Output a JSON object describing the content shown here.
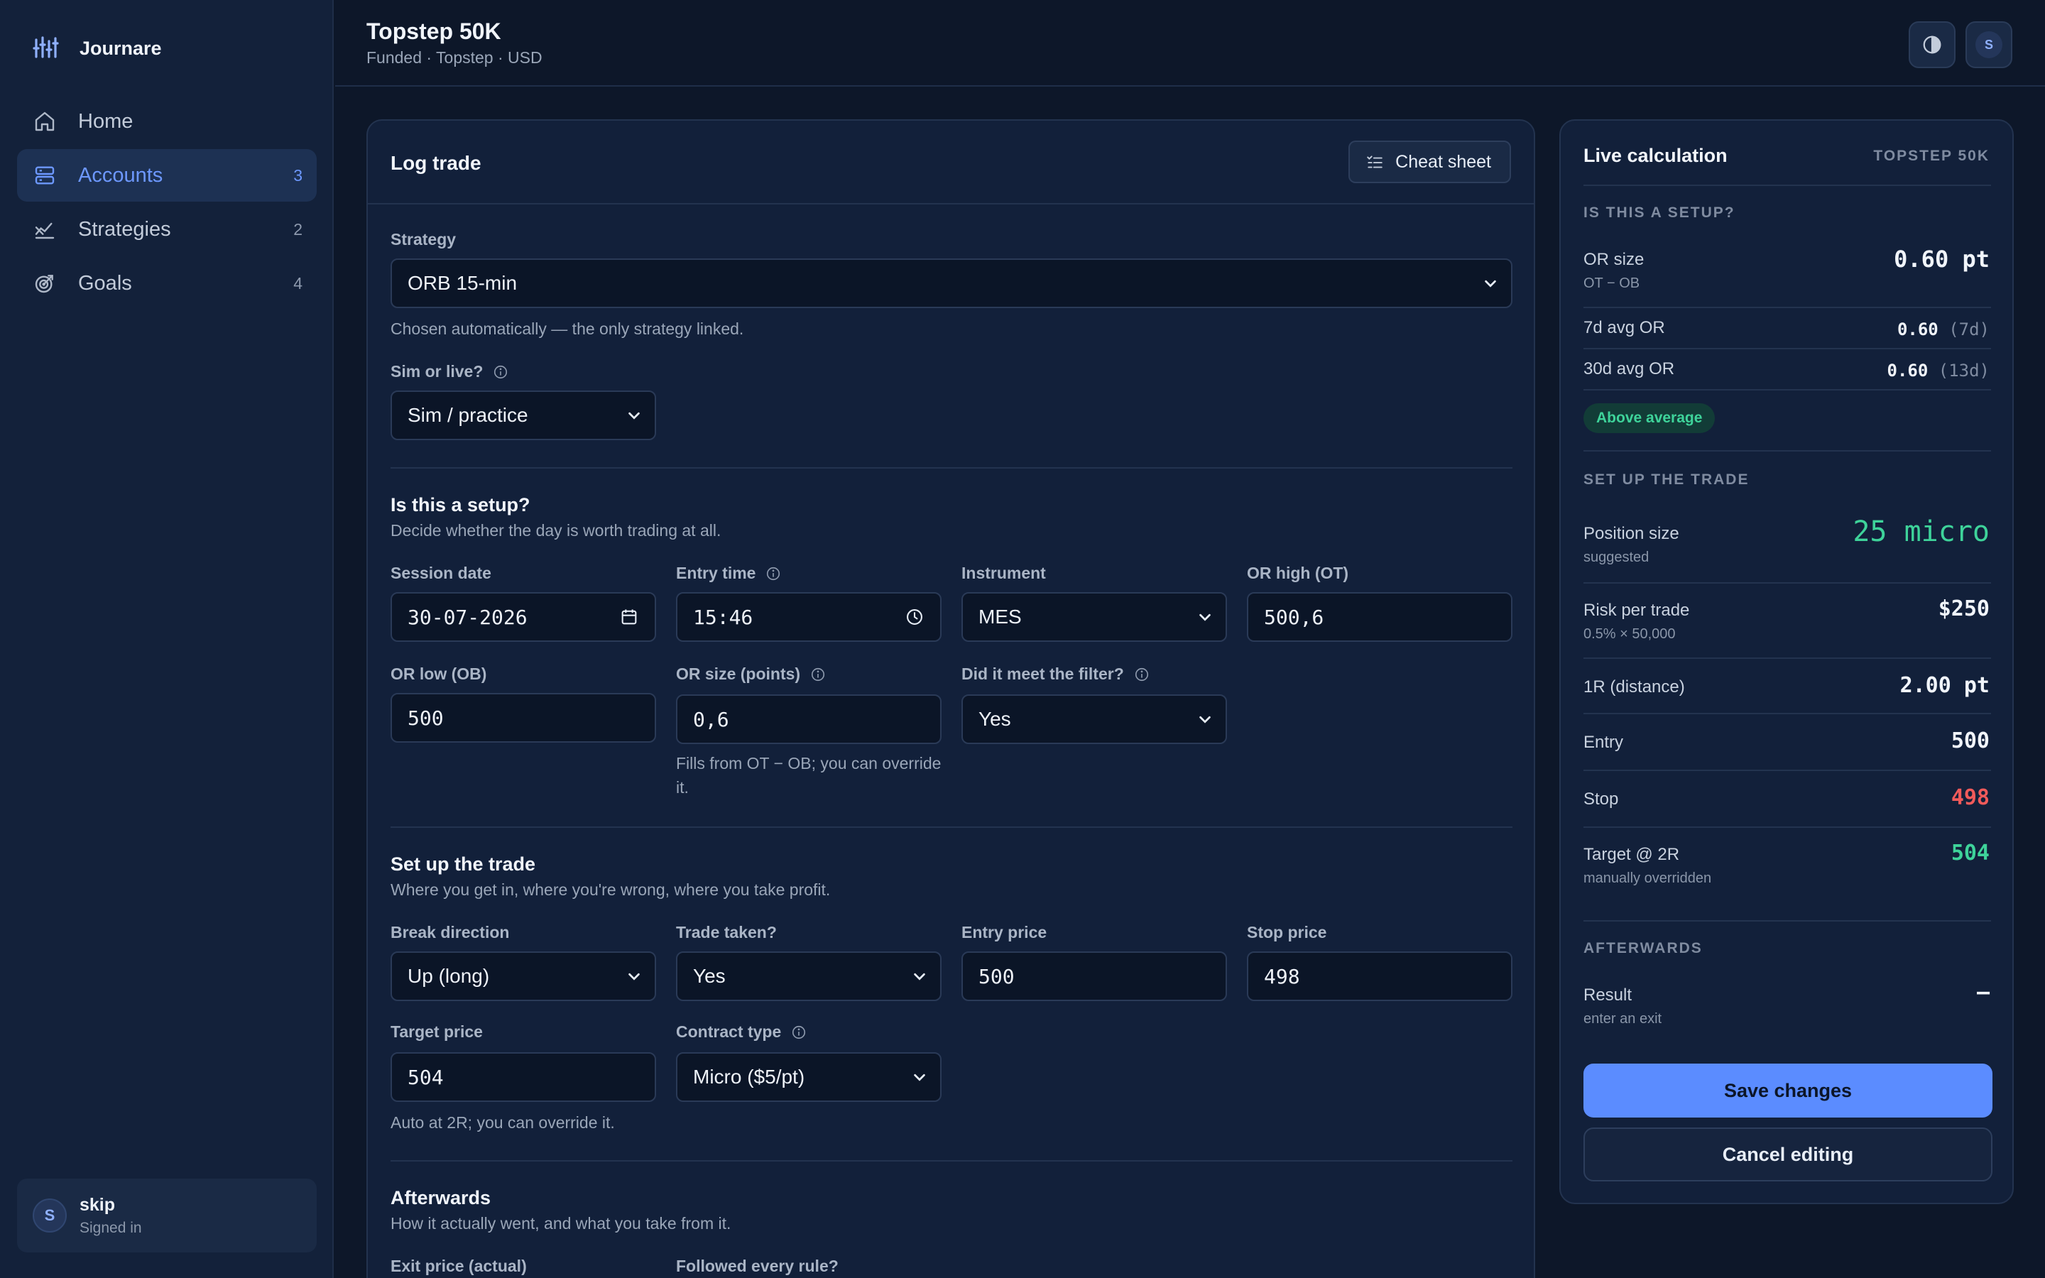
{
  "app": {
    "name": "Journare"
  },
  "nav": [
    {
      "label": "Home",
      "count": ""
    },
    {
      "label": "Accounts",
      "count": "3"
    },
    {
      "label": "Strategies",
      "count": "2"
    },
    {
      "label": "Goals",
      "count": "4"
    }
  ],
  "user": {
    "initial": "S",
    "name": "skip",
    "status": "Signed in"
  },
  "header": {
    "title": "Topstep 50K",
    "subtitle": "Funded · Topstep · USD",
    "avatar_initial": "S"
  },
  "form": {
    "title": "Log trade",
    "cheat_sheet_label": "Cheat sheet",
    "strategy": {
      "label": "Strategy",
      "value": "ORB 15-min",
      "help": "Chosen automatically — the only strategy linked."
    },
    "sim_live": {
      "label": "Sim or live?",
      "value": "Sim / practice"
    },
    "setup_section": {
      "title": "Is this a setup?",
      "subtitle": "Decide whether the day is worth trading at all."
    },
    "session_date": {
      "label": "Session date",
      "value": "30-07-2026"
    },
    "entry_time": {
      "label": "Entry time",
      "value": "15:46"
    },
    "instrument": {
      "label": "Instrument",
      "value": "MES"
    },
    "or_high": {
      "label": "OR high (OT)",
      "value": "500,6"
    },
    "or_low": {
      "label": "OR low (OB)",
      "value": "500"
    },
    "or_size": {
      "label": "OR size (points)",
      "value": "0,6",
      "help": "Fills from OT − OB; you can override it."
    },
    "met_filter": {
      "label": "Did it meet the filter?",
      "value": "Yes"
    },
    "trade_section": {
      "title": "Set up the trade",
      "subtitle": "Where you get in, where you're wrong, where you take profit."
    },
    "break_direction": {
      "label": "Break direction",
      "value": "Up (long)"
    },
    "trade_taken": {
      "label": "Trade taken?",
      "value": "Yes"
    },
    "entry_price": {
      "label": "Entry price",
      "value": "500"
    },
    "stop_price": {
      "label": "Stop price",
      "value": "498"
    },
    "target_price": {
      "label": "Target price",
      "value": "504",
      "help": "Auto at 2R; you can override it."
    },
    "contract_type": {
      "label": "Contract type",
      "value": "Micro ($5/pt)"
    },
    "after_section": {
      "title": "Afterwards",
      "subtitle": "How it actually went, and what you take from it."
    },
    "exit_price": {
      "label": "Exit price (actual)"
    },
    "followed_rule": {
      "label": "Followed every rule?"
    }
  },
  "calc": {
    "title": "Live calculation",
    "account": "TOPSTEP 50K",
    "section_setup": "IS THIS A SETUP?",
    "or_size_label": "OR size",
    "or_size_sub": "OT − OB",
    "or_size_value": "0.60 pt",
    "avg7_label": "7d avg OR",
    "avg7_value": "0.60",
    "avg7_note": "(7d)",
    "avg30_label": "30d avg OR",
    "avg30_value": "0.60",
    "avg30_note": "(13d)",
    "badge": "Above average",
    "section_trade": "SET UP THE TRADE",
    "position_label": "Position size",
    "position_sub": "suggested",
    "position_value": "25 micro",
    "risk_label": "Risk per trade",
    "risk_sub": "0.5% × 50,000",
    "risk_value": "$250",
    "r1_label": "1R (distance)",
    "r1_value": "2.00 pt",
    "entry_label": "Entry",
    "entry_value": "500",
    "stop_label": "Stop",
    "stop_value": "498",
    "target_label": "Target @ 2R",
    "target_sub": "manually overridden",
    "target_value": "504",
    "section_after": "AFTERWARDS",
    "result_label": "Result",
    "result_sub": "enter an exit",
    "result_value": "—",
    "save_label": "Save changes",
    "cancel_label": "Cancel editing"
  },
  "colors": {
    "accent": "#5b8cff",
    "positive": "#3ed39a",
    "negative": "#f05a5a",
    "background": "#0d1729"
  }
}
